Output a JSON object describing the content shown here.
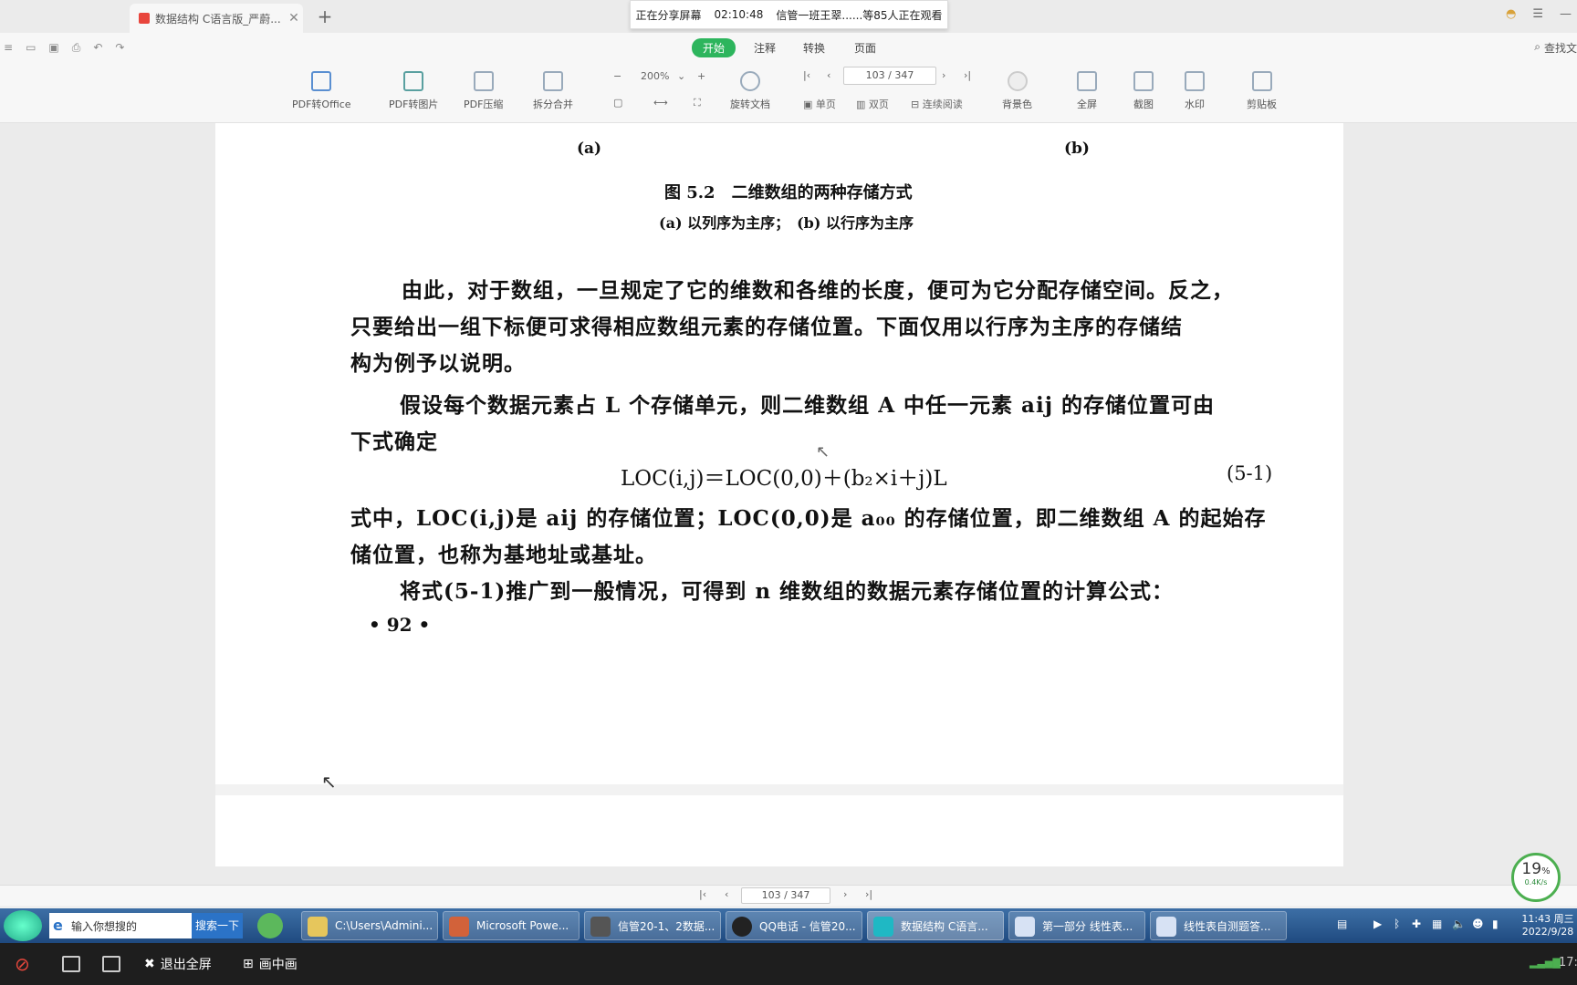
{
  "window": {
    "tab_title": "数据结构 C语言版_严蔚...",
    "share_status": "正在分享屏幕",
    "share_time": "02:10:48",
    "viewers": "信管一班王翠......等85人正在观看"
  },
  "menu": {
    "items": [
      "开始",
      "注释",
      "转换",
      "页面"
    ],
    "search_label": "查找文"
  },
  "toolbar": {
    "pdf_to_office": "PDF转Office",
    "pdf_to_image": "PDF转图片",
    "pdf_compress": "PDF压缩",
    "split_merge": "拆分合并",
    "zoom": "200%",
    "rotate": "旋转文档",
    "current_page": "103",
    "total_pages": "/ 347",
    "single_page": "单页",
    "double_page": "双页",
    "continuous": "连续阅读",
    "background": "背景色",
    "fullscreen": "全屏",
    "screenshot": "截图",
    "watermark": "水印",
    "clipboard": "剪贴板"
  },
  "document": {
    "label_a": "(a)",
    "label_b": "(b)",
    "figure_title": "图 5.2　二维数组的两种存储方式",
    "figure_subtitle": "(a) 以列序为主序；　(b) 以行序为主序",
    "p1_line1": "由此，对于数组，一旦规定了它的维数和各维的长度，便可为它分配存储空间。反之，",
    "p1_line2": "只要给出一组下标便可求得相应数组元素的存储位置。下面仅用以行序为主序的存储结",
    "p1_line3": "构为例予以说明。",
    "p2_line1": "假设每个数据元素占 L 个存储单元，则二维数组 A 中任一元素 aij 的存储位置可由",
    "p2_line2": "下式确定",
    "formula": "LOC(i,j)＝LOC(0,0)＋(b₂×i＋j)L",
    "formula_no": "(5-1)",
    "p3_line1": "式中，LOC(i,j)是 aij 的存储位置；LOC(0,0)是 a₀₀ 的存储位置，即二维数组 A 的起始存",
    "p3_line2": "储位置，也称为基地址或基址。",
    "p4_line1": "将式(5-1)推广到一般情况，可得到 n 维数组的数据元素存储位置的计算公式：",
    "page_number": "• 92 •"
  },
  "bottom_nav": {
    "current_page": "103",
    "total_pages": "/ 347"
  },
  "speed_widget": {
    "percent": "19",
    "unit": "%",
    "rate": "0.4K/s"
  },
  "taskbar": {
    "search_placeholder": "输入你想搜的",
    "search_button": "搜索一下",
    "tasks": [
      "C:\\Users\\Admini...",
      "Microsoft Powe...",
      "信管20-1、2数据...",
      "QQ电话 - 信管20...",
      "数据结构 C语言...",
      "第一部分 线性表...",
      "线性表自测题答..."
    ],
    "clock_time": "11:43 周三",
    "clock_date": "2022/9/28"
  },
  "meeting_bar": {
    "exit_fullscreen": "退出全屏",
    "picture_in_picture": "画中画",
    "right_time": "17:"
  }
}
